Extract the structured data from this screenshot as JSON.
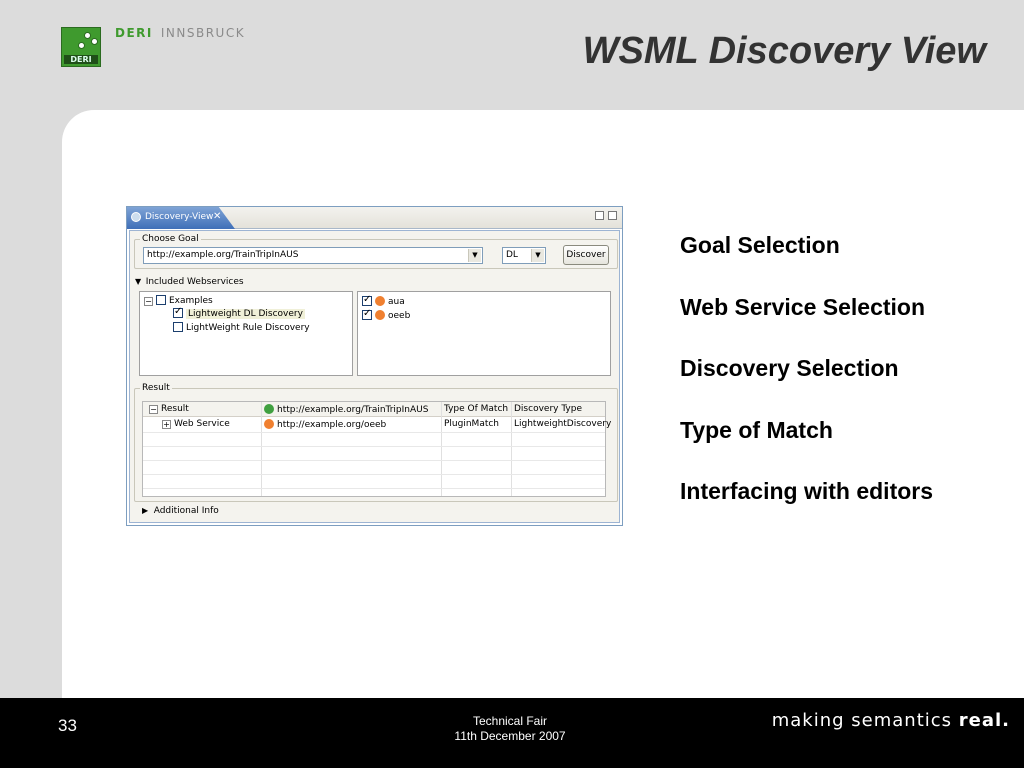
{
  "header": {
    "logo_label": "DERI",
    "brand_primary": "DERI",
    "brand_secondary": "INNSBRUCK",
    "title": "WSML Discovery View"
  },
  "bullets": [
    "Goal Selection",
    "Web Service Selection",
    "Discovery Selection",
    "Type of Match",
    "Interfacing with editors"
  ],
  "footer": {
    "page_number": "33",
    "event": "Technical Fair",
    "date": "11th December 2007",
    "tagline_prefix": "making semantics ",
    "tagline_emphasis": "real."
  },
  "view": {
    "tab_label": "Discovery-View",
    "choose_goal": {
      "label": "Choose Goal",
      "goal_value": "http://example.org/TrainTripInAUS",
      "discovery_type_value": "DL",
      "discover_button": "Discover"
    },
    "included_webservices": {
      "label": "Included Webservices",
      "tree": {
        "root": "Examples",
        "children": [
          {
            "label": "Lightweight DL Discovery",
            "checked": true
          },
          {
            "label": "LightWeight Rule Discovery",
            "checked": false
          }
        ]
      },
      "services": [
        {
          "label": "aua",
          "checked": true
        },
        {
          "label": "oeeb",
          "checked": true
        }
      ]
    },
    "result": {
      "label": "Result",
      "columns": [
        "Result",
        "http://example.org/TrainTripInAUS",
        "Type Of Match",
        "Discovery Type"
      ],
      "rows": [
        {
          "name": "Web Service",
          "uri": "http://example.org/oeeb",
          "match": "PluginMatch",
          "discovery": "LightweightDiscovery"
        }
      ]
    },
    "additional_info": "Additional Info"
  },
  "colors": {
    "deri_green": "#3f9a2e",
    "tab_blue": "#3f6fb8",
    "footer_bg": "#000000",
    "slide_bg": "#dcdcdc"
  }
}
